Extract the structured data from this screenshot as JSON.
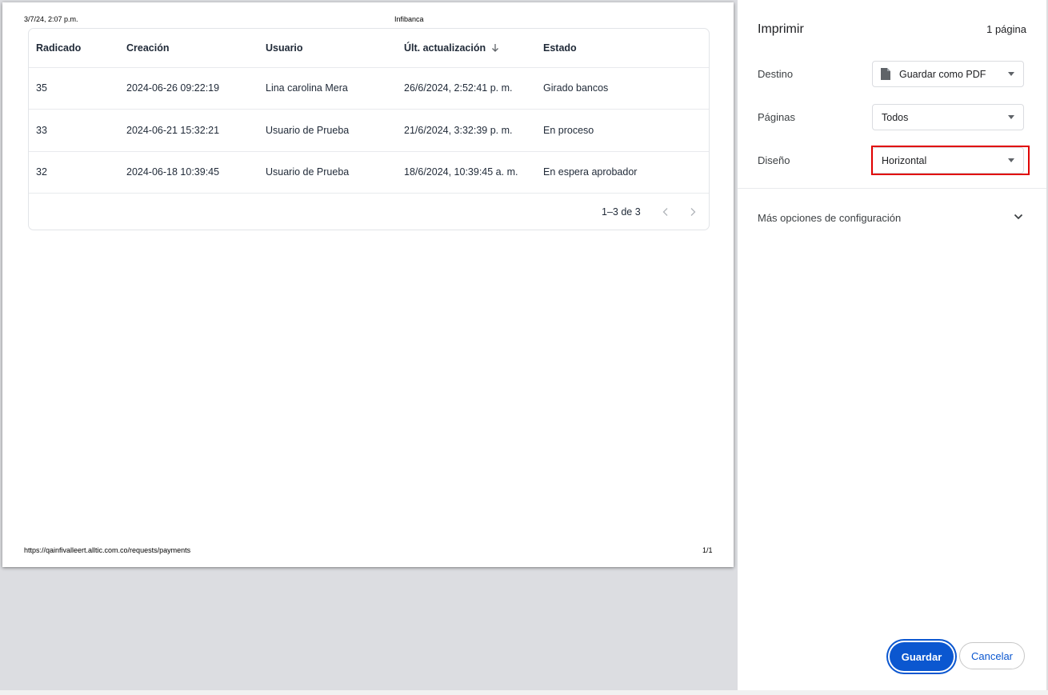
{
  "page": {
    "header_date": "3/7/24, 2:07 p.m.",
    "header_title": "Infibanca",
    "footer_url": "https://qainfivalleert.alltic.com.co/requests/payments",
    "footer_page": "1/1"
  },
  "table": {
    "columns": [
      "Radicado",
      "Creación",
      "Usuario",
      "Últ. actualización",
      "Estado"
    ],
    "sort_icon": "arrow-down-icon",
    "rows": [
      [
        "35",
        "2024-06-26 09:22:19",
        "Lina carolina Mera",
        "26/6/2024, 2:52:41 p. m.",
        "Girado bancos"
      ],
      [
        "33",
        "2024-06-21 15:32:21",
        "Usuario de Prueba",
        "21/6/2024, 3:32:39 p. m.",
        "En proceso"
      ],
      [
        "32",
        "2024-06-18 10:39:45",
        "Usuario de Prueba",
        "18/6/2024, 10:39:45 a. m.",
        "En espera aprobador"
      ]
    ],
    "pagination": "1–3 de 3"
  },
  "panel": {
    "title": "Imprimir",
    "page_count": "1 página",
    "destination_label": "Destino",
    "destination_value": "Guardar como PDF",
    "pages_label": "Páginas",
    "pages_value": "Todos",
    "layout_label": "Diseño",
    "layout_value": "Horizontal",
    "more_options": "Más opciones de configuración",
    "save_button": "Guardar",
    "cancel_button": "Cancelar"
  },
  "colors": {
    "accent": "#0b57d0",
    "highlight": "#e00000",
    "preview_bg": "#dcdde1"
  }
}
